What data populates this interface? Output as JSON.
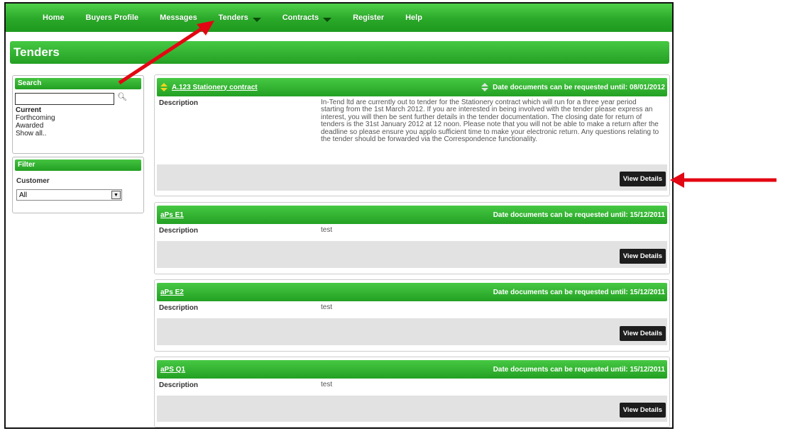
{
  "nav": {
    "items": [
      {
        "label": "Home",
        "dropdown": false
      },
      {
        "label": "Buyers Profile",
        "dropdown": false
      },
      {
        "label": "Messages",
        "dropdown": false
      },
      {
        "label": "Tenders",
        "dropdown": true
      },
      {
        "label": "Contracts",
        "dropdown": true
      },
      {
        "label": "Register",
        "dropdown": false
      },
      {
        "label": "Help",
        "dropdown": false
      }
    ]
  },
  "page": {
    "title": "Tenders"
  },
  "sidebar": {
    "search": {
      "heading": "Search",
      "value": "",
      "links": [
        "Current",
        "Forthcoming",
        "Awarded",
        "Show all.."
      ]
    },
    "filter": {
      "heading": "Filter",
      "customer_label": "Customer",
      "customer_selected": "All"
    }
  },
  "tenders": [
    {
      "title": "A.123 Stationery contract",
      "date_text": "Date documents can be requested until: 08/01/2012",
      "description_label": "Description",
      "description": "In-Tend ltd are currently out to tender for the Stationery contract which will run for a three year period starting from the 1st March 2012. If you are interested in being involved with the tender please express an interest, you will then be sent further details in the tender documentation. The closing date for return of tenders is the 31st January 2012 at 12 noon. Please note that you will not be able to make a return after the deadline so please ensure you applo sufficient time to make your electronic return. Any questions relating to the tender should be forwarded via the Correspondence functionality.",
      "button": "View Details"
    },
    {
      "title": "aPs E1",
      "date_text": "Date documents can be requested until: 15/12/2011",
      "description_label": "Description",
      "description": "test",
      "button": "View Details"
    },
    {
      "title": "aPs E2",
      "date_text": "Date documents can be requested until: 15/12/2011",
      "description_label": "Description",
      "description": "test",
      "button": "View Details"
    },
    {
      "title": "aPS Q1",
      "date_text": "Date documents can be requested until: 15/12/2011",
      "description_label": "Description",
      "description": "test",
      "button": "View Details"
    }
  ],
  "colors": {
    "brand_green": "#2aa829",
    "annotation_red": "#e30613",
    "button_dark": "#1d1d1d"
  }
}
